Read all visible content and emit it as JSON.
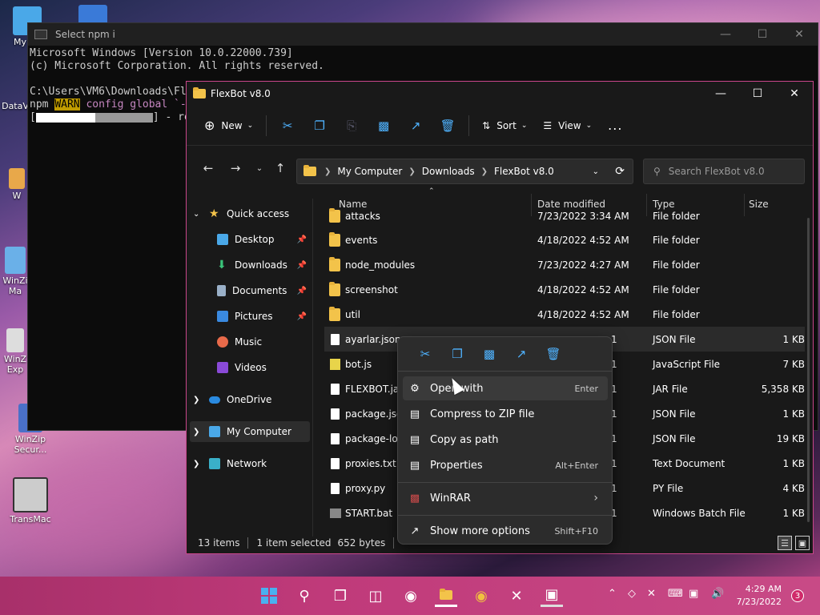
{
  "desktop": {
    "icons": [
      {
        "label": "My Co",
        "icon": "my-computer-icon"
      },
      {
        "label": "DataV",
        "icon": "datav-icon"
      },
      {
        "label": "W",
        "icon": "app-icon"
      },
      {
        "label": "WinZi Ma",
        "icon": "winzip-icon"
      },
      {
        "label": "WinZ Exp",
        "icon": "pdf-icon"
      },
      {
        "label": "WinZip Secur...",
        "icon": "winzip-secure-icon"
      },
      {
        "label": "TransMac",
        "icon": "transmac-icon"
      }
    ]
  },
  "cmd": {
    "title": "Select npm i",
    "line1": "Microsoft Windows [Version 10.0.22000.739]",
    "line2": "(c) Microsoft Corporation. All rights reserved.",
    "line3": "C:\\Users\\VM6\\Downloads\\Fl",
    "line4_prefix": "npm ",
    "line4_warn": "WARN",
    "line4_rest": " config global `-",
    "line5_rest": "] - re"
  },
  "explorer": {
    "title": "FlexBot v8.0",
    "toolbar": {
      "new": "New",
      "sort": "Sort",
      "view": "View",
      "more": "..."
    },
    "address": {
      "crumbs": [
        "My Computer",
        "Downloads",
        "FlexBot v8.0"
      ]
    },
    "search_placeholder": "Search FlexBot v8.0",
    "columns": {
      "name": "Name",
      "date": "Date modified",
      "type": "Type",
      "size": "Size"
    },
    "nav": {
      "quick_access": "Quick access",
      "desktop": "Desktop",
      "downloads": "Downloads",
      "documents": "Documents",
      "pictures": "Pictures",
      "music": "Music",
      "videos": "Videos",
      "onedrive": "OneDrive",
      "my_computer": "My Computer",
      "network": "Network"
    },
    "files": [
      {
        "name": "attacks",
        "date": "7/23/2022 3:34 AM",
        "type": "File folder",
        "size": ""
      },
      {
        "name": "events",
        "date": "4/18/2022 4:52 AM",
        "type": "File folder",
        "size": ""
      },
      {
        "name": "node_modules",
        "date": "7/23/2022 4:27 AM",
        "type": "File folder",
        "size": ""
      },
      {
        "name": "screenshot",
        "date": "4/18/2022 4:52 AM",
        "type": "File folder",
        "size": ""
      },
      {
        "name": "util",
        "date": "4/18/2022 4:52 AM",
        "type": "File folder",
        "size": ""
      },
      {
        "name": "ayarlar.json",
        "date": "1",
        "type": "JSON File",
        "size": "1 KB"
      },
      {
        "name": "bot.js",
        "date": "1",
        "type": "JavaScript File",
        "size": "7 KB"
      },
      {
        "name": "FLEXBOT.jar",
        "date": "1",
        "type": "JAR File",
        "size": "5,358 KB"
      },
      {
        "name": "package.json",
        "date": "1",
        "type": "JSON File",
        "size": "1 KB"
      },
      {
        "name": "package-loc",
        "date": "1",
        "type": "JSON File",
        "size": "19 KB"
      },
      {
        "name": "proxies.txt",
        "date": "1",
        "type": "Text Document",
        "size": "1 KB"
      },
      {
        "name": "proxy.py",
        "date": "1",
        "type": "PY File",
        "size": "4 KB"
      },
      {
        "name": "START.bat",
        "date": "1",
        "type": "Windows Batch File",
        "size": "1 KB"
      }
    ],
    "status": {
      "items": "13 items",
      "selected": "1 item selected",
      "bytes": "652 bytes"
    }
  },
  "context_menu": {
    "items": [
      {
        "label": "Open with",
        "key": "Enter"
      },
      {
        "label": "Compress to ZIP file",
        "key": ""
      },
      {
        "label": "Copy as path",
        "key": ""
      },
      {
        "label": "Properties",
        "key": "Alt+Enter"
      },
      {
        "label": "WinRAR",
        "key": "›"
      },
      {
        "label": "Show more options",
        "key": "Shift+F10"
      }
    ]
  },
  "taskbar": {
    "time": "4:29 AM",
    "date": "7/23/2022",
    "notifications": "3"
  }
}
